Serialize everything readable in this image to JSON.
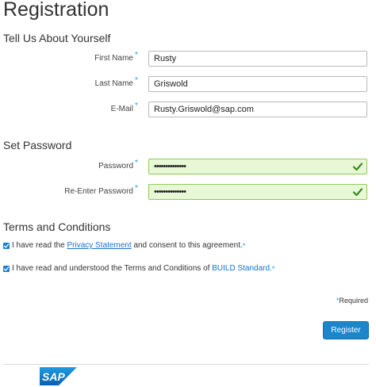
{
  "page": {
    "title": "Registration"
  },
  "about": {
    "heading": "Tell Us About Yourself",
    "first_name": {
      "label": "First Name",
      "value": "Rusty",
      "required": "*"
    },
    "last_name": {
      "label": "Last Name",
      "value": "Griswold",
      "required": "*"
    },
    "email": {
      "label": "E-Mail",
      "value": "Rusty.Griswold@sap.com",
      "required": "*"
    }
  },
  "password": {
    "heading": "Set Password",
    "password": {
      "label": "Password",
      "value": "••••••••••••••",
      "required": "*",
      "status": "valid"
    },
    "confirm": {
      "label": "Re-Enter Password",
      "value": "••••••••••••••",
      "required": "*",
      "status": "valid"
    }
  },
  "terms": {
    "heading": "Terms and Conditions",
    "privacy": {
      "checked": true,
      "prefix": "I have read the",
      "link": "Privacy Statement",
      "suffix": "and consent to this agreement.",
      "required": "*"
    },
    "build": {
      "checked": true,
      "prefix": "I have read and understood the Terms and Conditions of",
      "link": "BUILD Standard.",
      "required": "*"
    }
  },
  "footer": {
    "required_star": "*",
    "required_label": "Required",
    "register_label": "Register",
    "logo_text": "SAP"
  },
  "colors": {
    "accent": "#1b86c9",
    "valid_bg": "#e8f7d6",
    "check": "#3a8a1e"
  }
}
